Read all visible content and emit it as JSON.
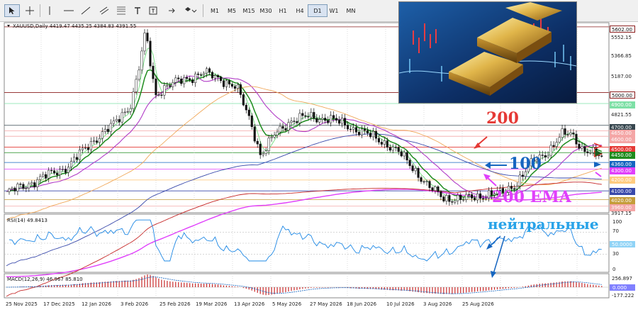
{
  "toolbar": {
    "timeframes": [
      "M1",
      "M5",
      "M15",
      "M30",
      "H1",
      "H4",
      "D1",
      "W1",
      "MN"
    ],
    "active_timeframe": "D1",
    "tools": [
      "cursor-icon",
      "crosshair-icon",
      "vertical-line-icon",
      "horizontal-line-icon",
      "trendline-icon",
      "channel-icon",
      "fibonacci-icon",
      "text-icon",
      "label-icon",
      "shapes-icon"
    ]
  },
  "chart": {
    "header": "XAUUSD,Daily  4419.47 4435.25 4384.83 4391.55",
    "price_labels": {
      "p5602": "5602.00",
      "p5552": "5552.15",
      "p5366": "5366.85",
      "p5187": "5187.00",
      "p5000": "5000.00",
      "p4900": "4900.00",
      "p4821": "4821.55",
      "p4700": "4700.00",
      "p4650": "4650.00",
      "p4600": "4600.00",
      "p4500": "4500.00",
      "p4450": "4450.00",
      "p4360": "4360.00",
      "p4300": "4300.00",
      "p4200": "4200.00",
      "p4100": "4100.00",
      "p4020": "4020.00",
      "p3960": "3960.00",
      "p3917": "3917.15"
    },
    "dates": [
      "25 Nov 2025",
      "17 Dec 2025",
      "12 Jan 2026",
      "3 Feb 2026",
      "25 Feb 2026",
      "19 Mar 2026",
      "13 Apr 2026",
      "5 May 2026",
      "27 May 2026",
      "18 Jun 2026",
      "10 Jul 2026",
      "3 Aug 2026",
      "25 Aug 2026"
    ]
  },
  "rsi": {
    "header": "RSI(14) 49.8413",
    "labels": {
      "l100": "100",
      "l70": "70",
      "l50": "50.0000",
      "l30": "30",
      "l0": "0"
    }
  },
  "macd": {
    "header": "MACD(12,26,9) 46.967 85.810",
    "labels": {
      "top": "256.897",
      "zero": "0.000",
      "bottom": "-177.222"
    }
  },
  "annotations": {
    "sma200": "200",
    "sma100": "100",
    "ema200": "200 EMA",
    "neutral": "нейтральные"
  },
  "colors": {
    "red_arrow": "#e53935",
    "green_arrow": "#1b5e20",
    "blue_arrow": "#1565c0",
    "magenta": "#e040fb",
    "ema_green": "#1e8c1e"
  }
}
